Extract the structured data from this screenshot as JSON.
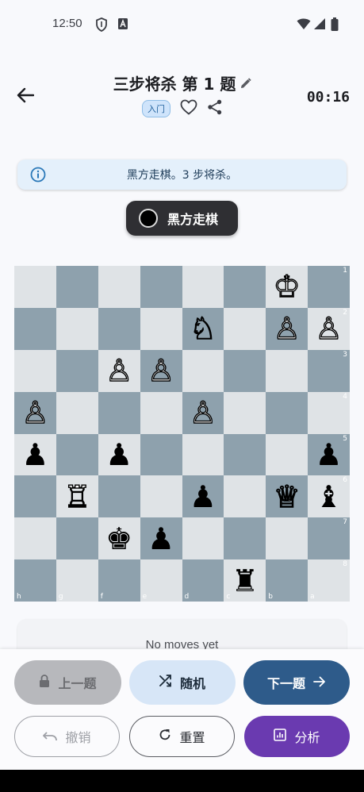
{
  "status_bar": {
    "time": "12:50"
  },
  "header": {
    "title": "三步将杀 第 1 题",
    "level_badge": "入门",
    "timer": "00:16"
  },
  "info": {
    "text": "黑方走棋。3 步将杀。"
  },
  "turn": {
    "label": "黑方走棋"
  },
  "board": {
    "rank_labels": [
      "1",
      "2",
      "3",
      "4",
      "5",
      "6",
      "7",
      "8"
    ],
    "file_labels": [
      "h",
      "g",
      "f",
      "e",
      "d",
      "c",
      "b",
      "a"
    ],
    "rows": [
      [
        "",
        "",
        "",
        "",
        "",
        "",
        "♔",
        ""
      ],
      [
        "",
        "",
        "",
        "",
        "♘",
        "",
        "♙",
        "♙"
      ],
      [
        "",
        "",
        "♙",
        "♙",
        "",
        "",
        "",
        ""
      ],
      [
        "♙",
        "",
        "",
        "",
        "♙",
        "",
        "",
        ""
      ],
      [
        "♟",
        "",
        "♟",
        "",
        "",
        "",
        "",
        "♟"
      ],
      [
        "",
        "♖",
        "",
        "",
        "♟",
        "",
        "♕",
        "♝"
      ],
      [
        "",
        "",
        "♚",
        "♟",
        "",
        "",
        "",
        ""
      ],
      [
        "",
        "",
        "",
        "",
        "",
        "♜",
        "",
        ""
      ]
    ],
    "colors": [
      [
        "",
        "",
        "",
        "",
        "",
        "",
        "w",
        ""
      ],
      [
        "",
        "",
        "",
        "",
        "w",
        "",
        "w",
        "w"
      ],
      [
        "",
        "",
        "w",
        "w",
        "",
        "",
        "",
        ""
      ],
      [
        "w",
        "",
        "",
        "",
        "w",
        "",
        "",
        ""
      ],
      [
        "b",
        "",
        "b",
        "",
        "",
        "",
        "",
        "b"
      ],
      [
        "",
        "w",
        "",
        "",
        "b",
        "",
        "w",
        "b"
      ],
      [
        "",
        "",
        "b",
        "b",
        "",
        "",
        "",
        ""
      ],
      [
        "",
        "",
        "",
        "",
        "",
        "b",
        "",
        ""
      ]
    ]
  },
  "moves": {
    "empty_text": "No moves yet"
  },
  "buttons": {
    "prev": "上一题",
    "random": "随机",
    "next": "下一题",
    "undo": "撤销",
    "reset": "重置",
    "analyze": "分析"
  }
}
